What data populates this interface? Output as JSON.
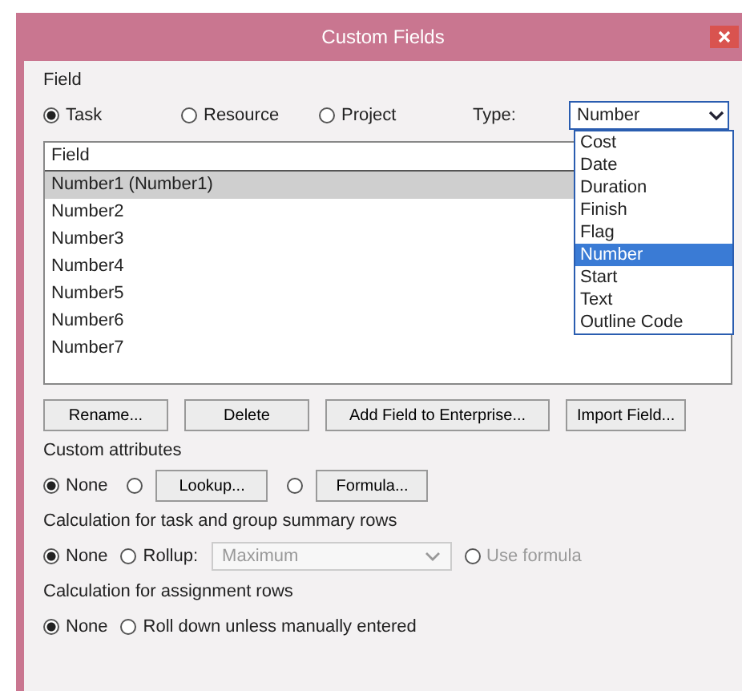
{
  "window": {
    "title": "Custom Fields"
  },
  "field_group": {
    "label": "Field",
    "radios": [
      {
        "label": "Task",
        "selected": true
      },
      {
        "label": "Resource",
        "selected": false
      },
      {
        "label": "Project",
        "selected": false
      }
    ],
    "type_label": "Type:",
    "type_dropdown": {
      "value": "Number",
      "expanded": true,
      "options": [
        {
          "label": "Cost",
          "selected": false
        },
        {
          "label": "Date",
          "selected": false
        },
        {
          "label": "Duration",
          "selected": false
        },
        {
          "label": "Finish",
          "selected": false
        },
        {
          "label": "Flag",
          "selected": false
        },
        {
          "label": "Number",
          "selected": true
        },
        {
          "label": "Start",
          "selected": false
        },
        {
          "label": "Text",
          "selected": false
        },
        {
          "label": "Outline Code",
          "selected": false
        }
      ]
    }
  },
  "fields_list": {
    "header": "Field",
    "rows": [
      {
        "label": "Number1 (Number1)",
        "selected": true
      },
      {
        "label": "Number2",
        "selected": false
      },
      {
        "label": "Number3",
        "selected": false
      },
      {
        "label": "Number4",
        "selected": false
      },
      {
        "label": "Number5",
        "selected": false
      },
      {
        "label": "Number6",
        "selected": false
      },
      {
        "label": "Number7",
        "selected": false
      }
    ]
  },
  "buttons": [
    "Rename...",
    "Delete",
    "Add Field to Enterprise...",
    "Import Field..."
  ],
  "custom_attributes": {
    "label": "Custom attributes",
    "options": [
      {
        "kind": "radio",
        "label": "None",
        "selected": true
      },
      {
        "kind": "button",
        "label": "Lookup...",
        "selected": false
      },
      {
        "kind": "button",
        "label": "Formula...",
        "selected": false
      }
    ]
  },
  "summary_rows": {
    "label": "Calculation for task and group summary rows",
    "options": [
      {
        "kind": "radio",
        "label": "None",
        "selected": true
      },
      {
        "kind": "radio",
        "label": "Rollup:",
        "selected": false
      },
      {
        "kind": "dropdown",
        "label": "Maximum",
        "disabled": true
      },
      {
        "kind": "radio",
        "label": "Use formula",
        "selected": false,
        "disabled": true
      }
    ]
  },
  "assignment_rows": {
    "label": "Calculation for assignment rows",
    "options": [
      {
        "kind": "radio",
        "label": "None",
        "selected": true
      },
      {
        "kind": "radio",
        "label": "Roll down unless manually entered",
        "selected": false
      }
    ]
  }
}
